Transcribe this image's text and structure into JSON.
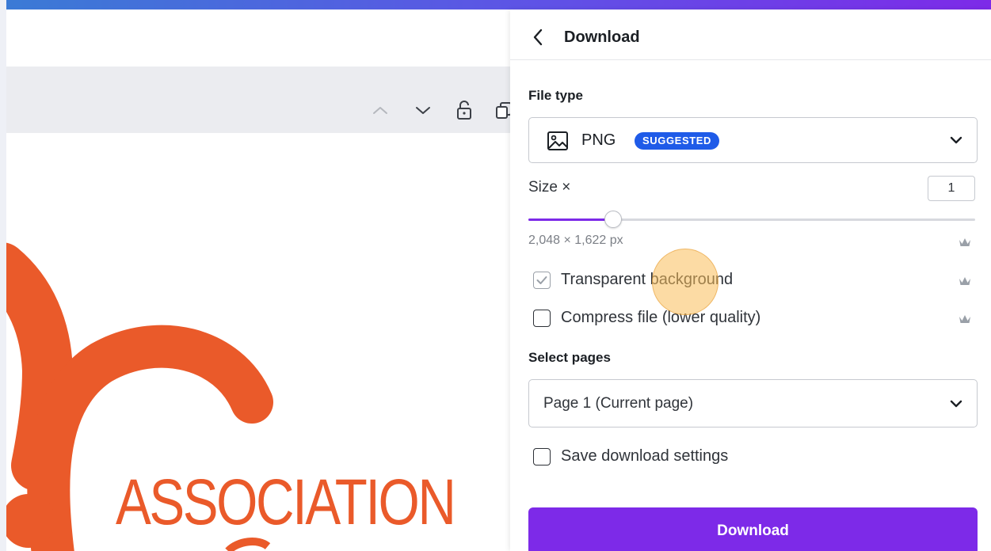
{
  "panel": {
    "title": "Download",
    "file_type": {
      "label": "File type",
      "value": "PNG",
      "badge": "SUGGESTED",
      "icon": "image-icon"
    },
    "size": {
      "label": "Size ×",
      "value": "1",
      "slider_fraction": 0.19,
      "dimensions": "2,048 × 1,622 px"
    },
    "options": [
      {
        "label": "Transparent background",
        "checked": true,
        "pro": true
      },
      {
        "label": "Compress file (lower quality)",
        "checked": false,
        "pro": true
      }
    ],
    "pages": {
      "label": "Select pages",
      "value": "Page 1 (Current page)"
    },
    "save_settings": {
      "label": "Save download settings",
      "checked": false
    },
    "download_label": "Download"
  },
  "canvas": {
    "text": "ASSOCIATION",
    "accent_color": "#ea5a2a"
  },
  "colors": {
    "brand_purple": "#7d2ae8",
    "badge_blue": "#1f5be8"
  }
}
